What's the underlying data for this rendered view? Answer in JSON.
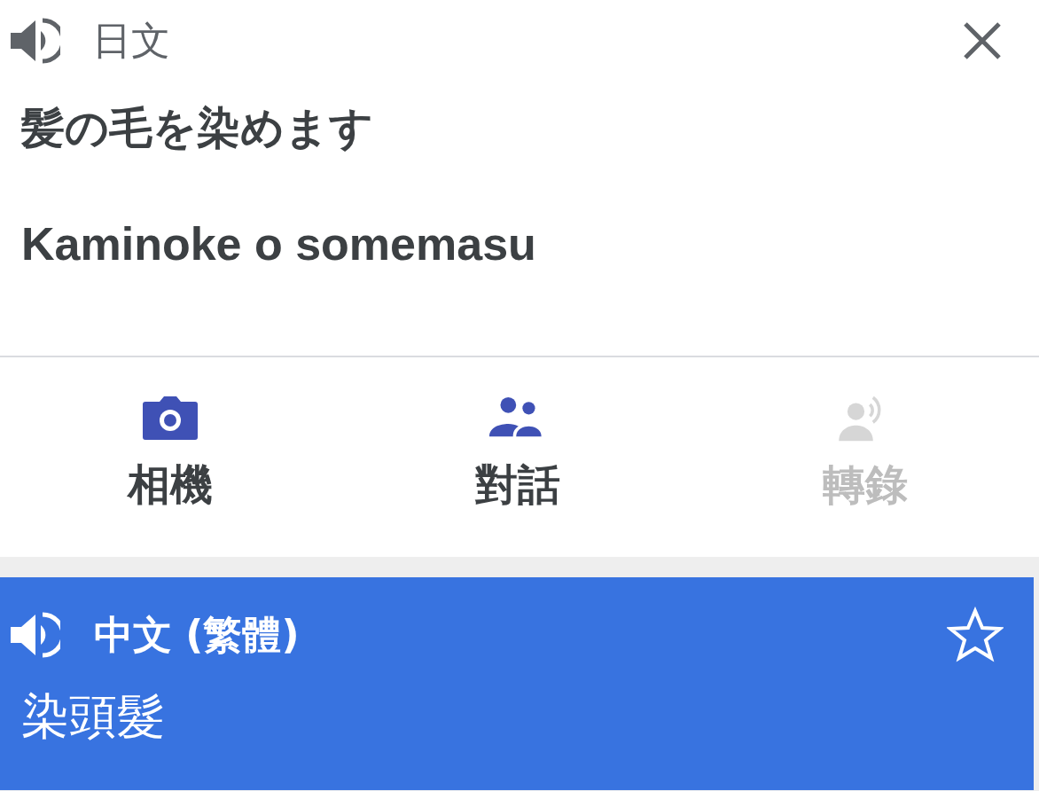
{
  "source": {
    "language": "日文",
    "text": "髪の毛を染めます",
    "romanization": "Kaminoke o somemasu"
  },
  "tools": [
    {
      "kind": "camera",
      "label": "相機",
      "disabled": false
    },
    {
      "kind": "conversation",
      "label": "對話",
      "disabled": false
    },
    {
      "kind": "transcribe",
      "label": "轉錄",
      "disabled": true
    }
  ],
  "result": {
    "language": "中文 (繁體)",
    "text": "染頭髮",
    "starred": false
  }
}
